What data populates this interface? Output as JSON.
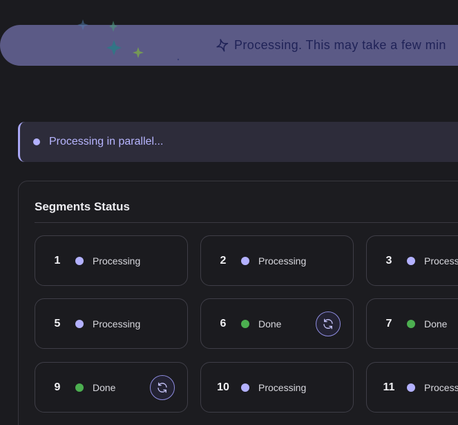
{
  "banner": {
    "text": "Processing. This may take a few min"
  },
  "notice": {
    "text": "Processing in parallel..."
  },
  "segments": {
    "title": "Segments Status",
    "items": [
      {
        "number": "1",
        "status": "Processing",
        "state": "processing"
      },
      {
        "number": "2",
        "status": "Processing",
        "state": "processing"
      },
      {
        "number": "3",
        "status": "Process",
        "state": "processing"
      },
      {
        "number": "5",
        "status": "Processing",
        "state": "processing"
      },
      {
        "number": "6",
        "status": "Done",
        "state": "done"
      },
      {
        "number": "7",
        "status": "Done",
        "state": "done"
      },
      {
        "number": "9",
        "status": "Done",
        "state": "done"
      },
      {
        "number": "10",
        "status": "Processing",
        "state": "processing"
      },
      {
        "number": "11",
        "status": "Process",
        "state": "processing"
      }
    ]
  },
  "colors": {
    "processing": "#b3b1ff",
    "done": "#4caf50",
    "accent": "#a9a7f5"
  }
}
